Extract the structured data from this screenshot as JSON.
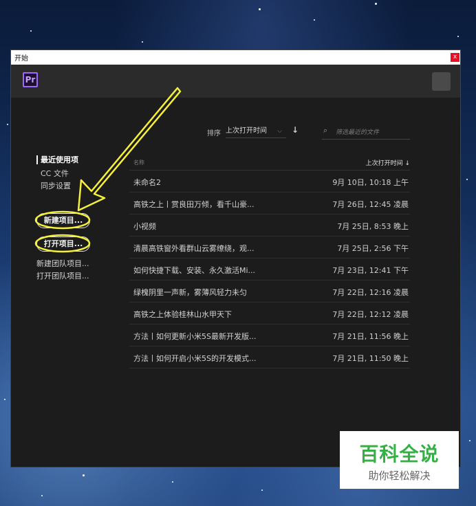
{
  "window": {
    "title": "开始",
    "close_label": "x"
  },
  "header": {
    "logo": "Pr"
  },
  "sidebar": {
    "recent": "最近使用项",
    "cc_files": "CC 文件",
    "sync_settings": "同步设置",
    "new_project": "新建项目...",
    "open_project": "打开项目...",
    "new_team_project": "新建团队项目...",
    "open_team_project": "打开团队项目..."
  },
  "toolbar": {
    "sort_label": "排序",
    "sort_value": "上次打开时间",
    "sort_direction_icon": "↓",
    "search_placeholder": "筛选最近的文件"
  },
  "table": {
    "col_name": "名称",
    "col_date": "上次打开时间 ↓",
    "rows": [
      {
        "name": "未命名2",
        "date": "9月 10日, 10:18 上午"
      },
      {
        "name": "高铁之上丨赏良田万倾，看千山豪...",
        "date": "7月 26日, 12:45 凌晨"
      },
      {
        "name": "小视频",
        "date": "7月 25日, 8:53 晚上"
      },
      {
        "name": "清晨高铁窗外看群山云雾缭绕，观...",
        "date": "7月 25日, 2:56 下午"
      },
      {
        "name": "如何快捷下载、安装、永久激活Mi...",
        "date": "7月 23日, 12:41 下午"
      },
      {
        "name": "绿槐阴里一声新，雾薄风轻力未匀",
        "date": "7月 22日, 12:16 凌晨"
      },
      {
        "name": "高铁之上体验桂林山水甲天下",
        "date": "7月 22日, 12:12 凌晨"
      },
      {
        "name": "方法丨如何更新小米5S最新开发版...",
        "date": "7月 21日, 11:56 晚上"
      },
      {
        "name": "方法丨如何开启小米5S的开发模式...",
        "date": "7月 21日, 11:50 晚上"
      }
    ]
  },
  "watermark": {
    "title": "百科全说",
    "subtitle": "助你轻松解决"
  },
  "colors": {
    "accent_purple": "#9d6aff",
    "annotation_yellow": "#f5f03a",
    "watermark_green": "#36b045"
  }
}
